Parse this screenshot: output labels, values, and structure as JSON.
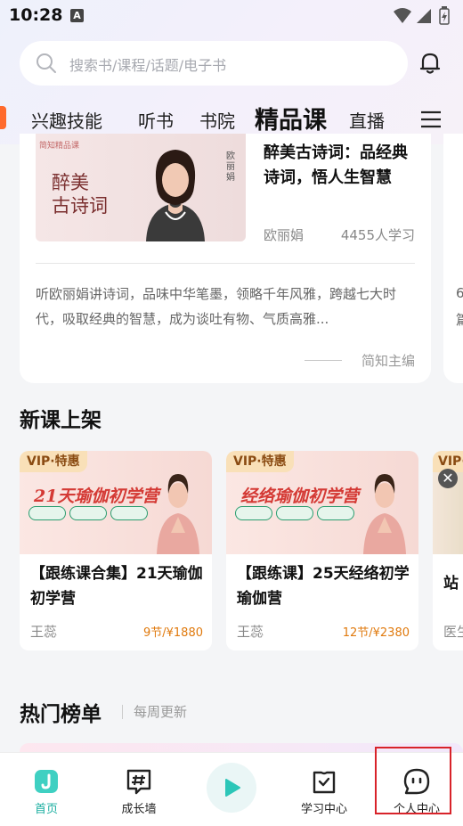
{
  "status_bar": {
    "time": "10:28",
    "notif_icon": "A"
  },
  "search": {
    "placeholder": "搜索书/课程/话题/电子书"
  },
  "tabs": [
    {
      "label": "兴趣技能"
    },
    {
      "label": "听书"
    },
    {
      "label": "书院"
    },
    {
      "label": "精品课",
      "active": true
    },
    {
      "label": "直播"
    }
  ],
  "featured": {
    "cover_title": "醉美\n古诗词",
    "cover_brand": "简知精品课",
    "cover_name": "欧丽娟",
    "title": "醉美古诗词：品经典诗词，悟人生智慧",
    "author": "欧丽娟",
    "learners": "4455人学习",
    "description": "听欧丽娟讲诗词，品味中华笔墨，领略千年风雅，跨越七大时代，吸取经典的智慧，成为谈吐有物、气质高雅...",
    "editor": "简知主编",
    "peek_text_1": "6",
    "peek_text_2": "篇"
  },
  "new_courses": {
    "heading": "新课上架",
    "items": [
      {
        "badge": "VIP·特惠",
        "cover_text": "21天瑜伽初学营",
        "title": "【跟练课合集】21天瑜伽初学营",
        "author": "王蕊",
        "price": "9节/¥1880"
      },
      {
        "badge": "VIP·特惠",
        "cover_text": "经络瑜伽初学营",
        "title": "【跟练课】25天经络初学瑜伽营",
        "author": "王蕊",
        "price": "12节/¥2380"
      },
      {
        "badge": "VIP·特惠",
        "title_peek": "站",
        "author_peek": "医生"
      }
    ]
  },
  "hot": {
    "heading": "热门榜单",
    "subtitle": "每周更新"
  },
  "bottom_nav": [
    {
      "label": "首页",
      "icon": "home-icon",
      "active": true
    },
    {
      "label": "成长墙",
      "icon": "hash-chat-icon"
    },
    {
      "label": "",
      "icon": "play-icon"
    },
    {
      "label": "学习中心",
      "icon": "book-icon"
    },
    {
      "label": "个人中心",
      "icon": "smiley-chat-icon"
    }
  ],
  "colors": {
    "accent": "#1ebfb0",
    "price": "#e07a0e",
    "highlight_box": "#d8232a"
  }
}
